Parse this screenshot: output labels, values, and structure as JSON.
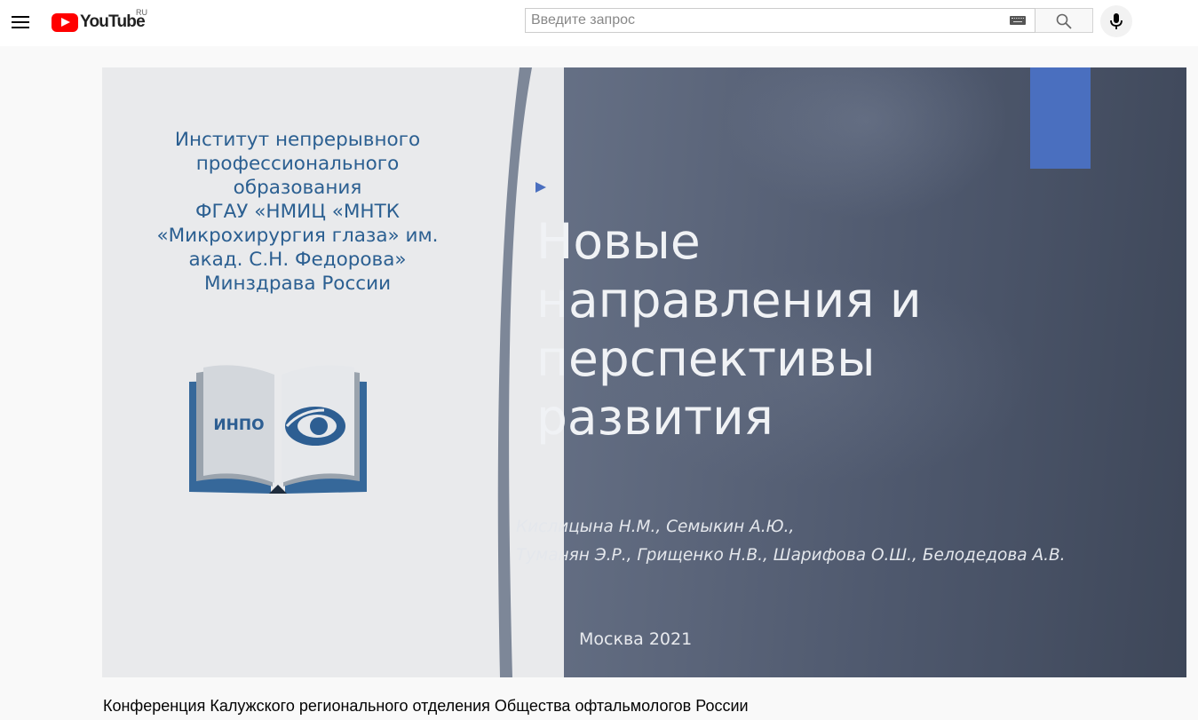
{
  "header": {
    "logo_text": "YouTube",
    "country_code": "RU",
    "search_placeholder": "Введите запрос"
  },
  "icons": {
    "menu": "hamburger-menu-icon",
    "keyboard": "keyboard-icon",
    "search": "search-icon",
    "mic": "microphone-icon"
  },
  "colors": {
    "brand_red": "#ff0000",
    "slide_text_blue": "#2b5f91",
    "slide_accent_blue": "#4a6fbf"
  },
  "slide": {
    "org_lines": [
      "Институт непрерывного",
      "профессионального",
      "образования",
      "ФГАУ «НМИЦ «МНТК",
      "«Микрохирургия глаза» им.",
      "акад. С.Н. Федорова»",
      "Минздрава России"
    ],
    "logo_label": "ИНПО",
    "title_lines": [
      "Новые",
      "направления и",
      "перспективы",
      "развития"
    ],
    "authors_lines": [
      "Кислицына Н.М., Семыкин А.Ю.,",
      "Туманян Э.Р., Грищенко Н.В., Шарифова О.Ш., Белодедова А.В."
    ],
    "city_year": "Москва 2021"
  },
  "video": {
    "title": "Конференция Калужского регионального отделения Общества офтальмологов России"
  }
}
